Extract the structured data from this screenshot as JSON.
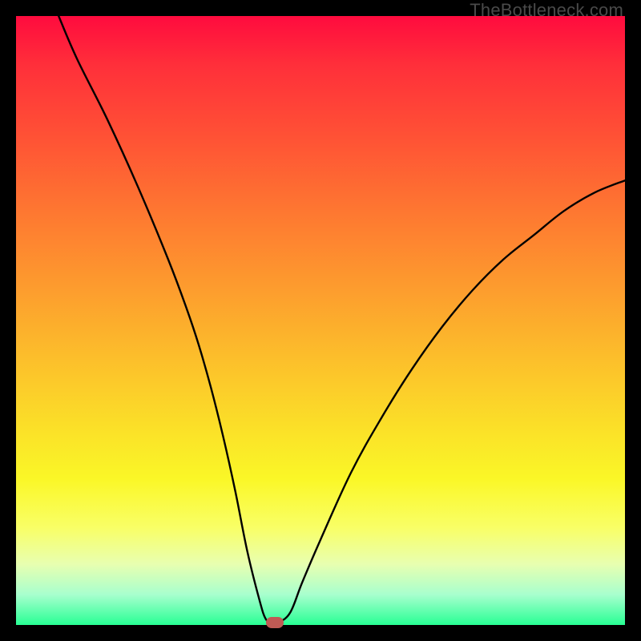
{
  "watermark": "TheBottleneck.com",
  "colors": {
    "frame": "#000000",
    "curve": "#000000",
    "marker": "#c05a54",
    "gradient_top": "#ff0b3e",
    "gradient_bottom": "#28ff94"
  },
  "chart_data": {
    "type": "line",
    "title": "",
    "xlabel": "",
    "ylabel": "",
    "xlim": [
      0,
      100
    ],
    "ylim": [
      0,
      100
    ],
    "x": [
      7,
      10,
      15,
      20,
      25,
      28,
      30,
      32,
      34,
      36,
      38,
      40,
      41,
      42,
      43,
      45,
      47,
      50,
      55,
      60,
      65,
      70,
      75,
      80,
      85,
      90,
      95,
      100
    ],
    "values": [
      100,
      93,
      83,
      72,
      60,
      52,
      46,
      39,
      31,
      22,
      12,
      4,
      1,
      0.4,
      0.4,
      2,
      7,
      14,
      25,
      34,
      42,
      49,
      55,
      60,
      64,
      68,
      71,
      73
    ],
    "minimum": {
      "x": 42.5,
      "y": 0.4
    },
    "legend": null,
    "grid": false,
    "annotations": []
  }
}
